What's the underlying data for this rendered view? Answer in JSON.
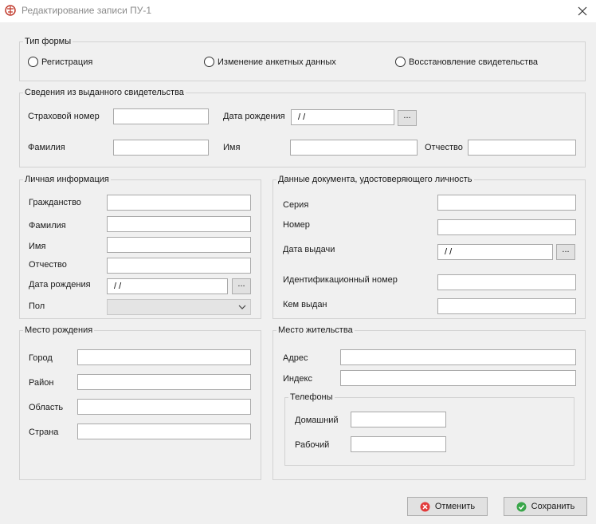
{
  "window": {
    "title": "Редактирование  записи ПУ-1"
  },
  "form_type": {
    "legend": "Тип формы",
    "options": [
      "Регистрация",
      "Изменение анкетных данных",
      "Восстановление свидетельства"
    ]
  },
  "issued_cert": {
    "legend": "Сведения из выданного свидетельства",
    "insurance_number_label": "Страховой номер",
    "birth_date_label": "Дата рождения",
    "birth_date_value": "/ /",
    "surname_label": "Фамилия",
    "name_label": "Имя",
    "patronymic_label": "Отчество"
  },
  "personal": {
    "legend": "Личная информация",
    "citizenship_label": "Гражданство",
    "surname_label": "Фамилия",
    "name_label": "Имя",
    "patronymic_label": "Отчество",
    "birth_date_label": "Дата рождения",
    "birth_date_value": "/ /",
    "gender_label": "Пол"
  },
  "id_doc": {
    "legend": "Данные документа, удостоверяющего личность",
    "series_label": "Серия",
    "number_label": "Номер",
    "issue_date_label": "Дата выдачи",
    "issue_date_value": "/ /",
    "id_number_label": "Идентификационный номер",
    "issued_by_label": "Кем выдан"
  },
  "birthplace": {
    "legend": "Место рождения",
    "city_label": "Город",
    "district_label": "Район",
    "region_label": "Область",
    "country_label": "Страна"
  },
  "residence": {
    "legend": "Место жительства",
    "address_label": "Адрес",
    "index_label": "Индекс",
    "phones_legend": "Телефоны",
    "home_label": "Домашний",
    "work_label": "Рабочий"
  },
  "common": {
    "picker_label": "..."
  },
  "buttons": {
    "cancel": "Отменить",
    "save": "Сохранить"
  },
  "colors": {
    "cancel_icon": "#e23b3b",
    "save_icon": "#3aa64a"
  }
}
